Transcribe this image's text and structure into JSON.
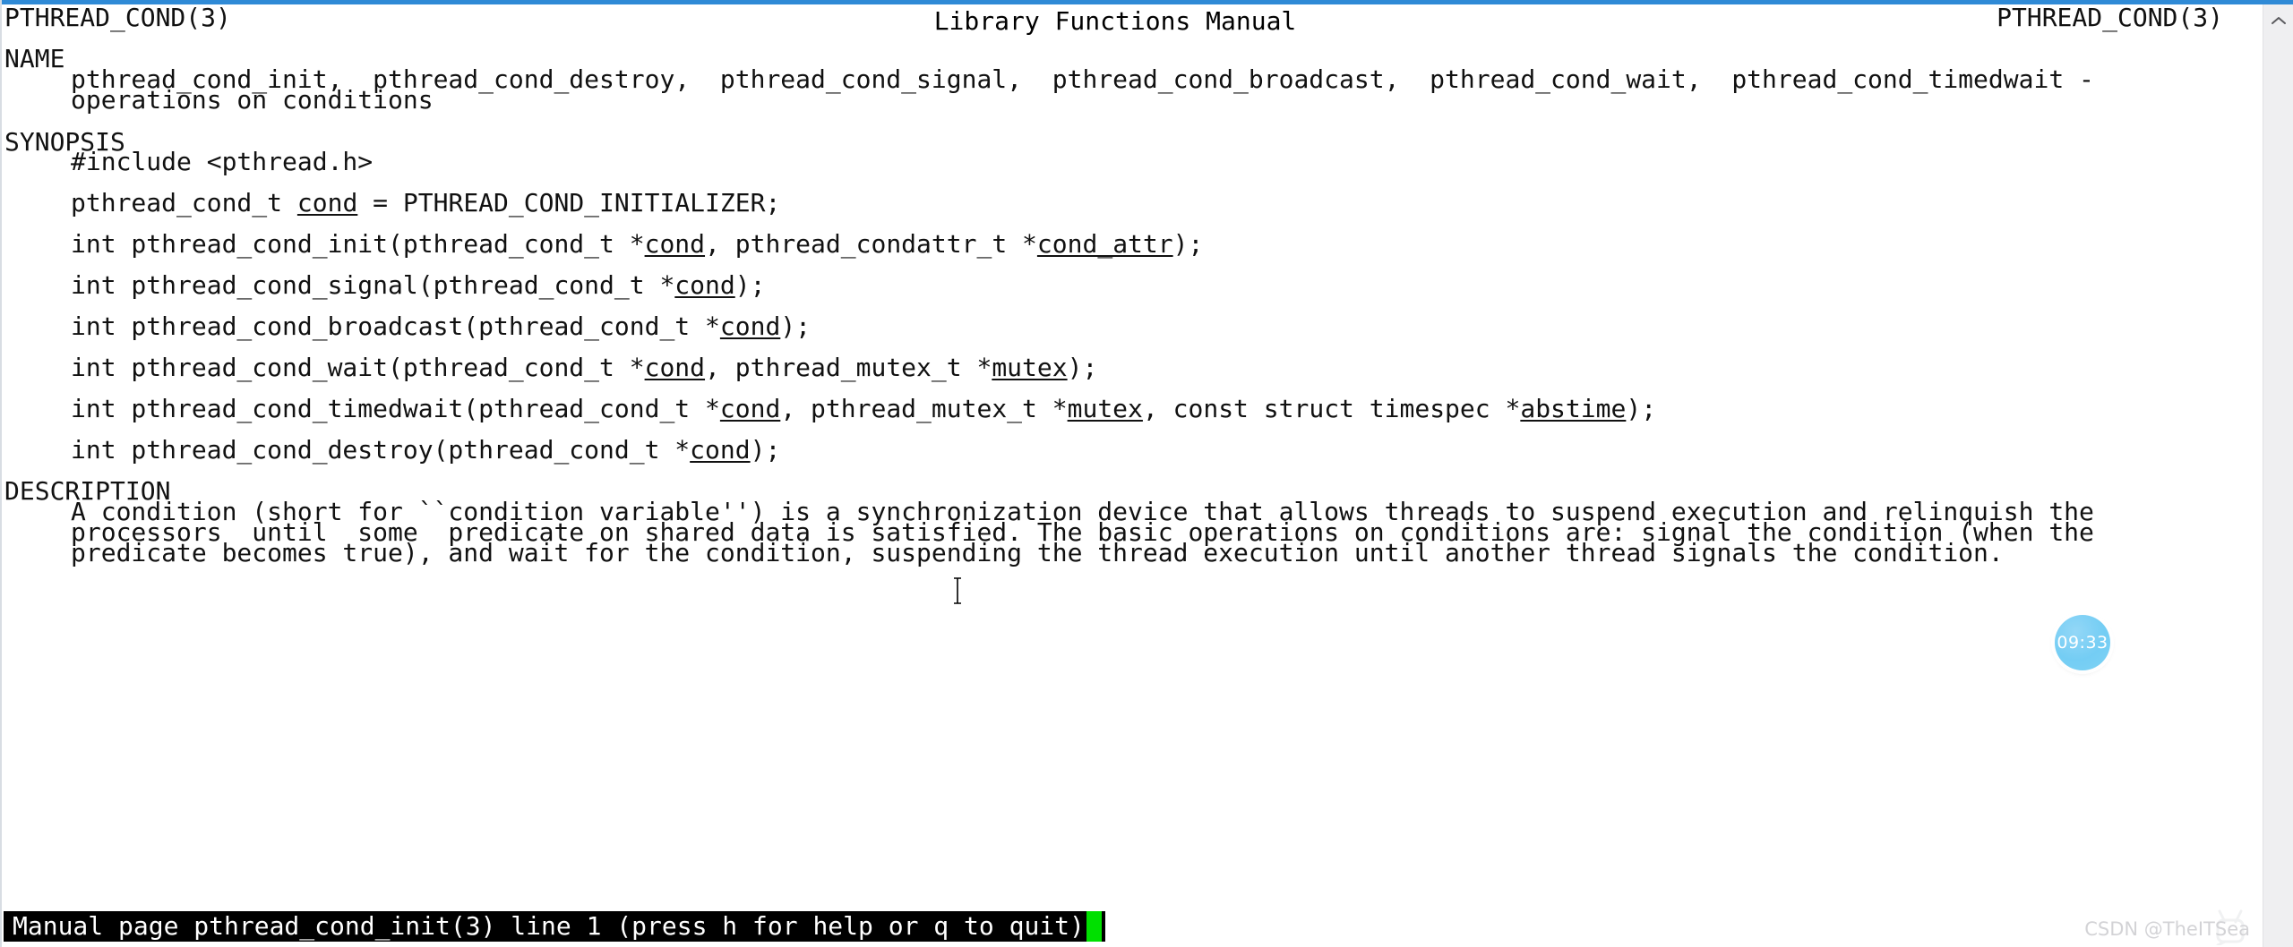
{
  "window": {
    "accent_color": "#2f8ad6",
    "background_color": "#ffffff",
    "text_color": "#000000"
  },
  "manpage": {
    "header": {
      "left": "PTHREAD_COND(3)",
      "center": "Library Functions Manual",
      "right": "PTHREAD_COND(3)"
    },
    "sections": [
      {
        "heading": "NAME",
        "lines": [
          "pthread_cond_init,  pthread_cond_destroy,  pthread_cond_signal,  pthread_cond_broadcast,  pthread_cond_wait,  pthread_cond_timedwait -",
          "operations on conditions"
        ]
      },
      {
        "heading": "SYNOPSIS",
        "lines": [
          "#include <pthread.h>",
          "pthread_cond_t cond = PTHREAD_COND_INITIALIZER;",
          "int pthread_cond_init(pthread_cond_t *cond, pthread_condattr_t *cond_attr);",
          "int pthread_cond_signal(pthread_cond_t *cond);",
          "int pthread_cond_broadcast(pthread_cond_t *cond);",
          "int pthread_cond_wait(pthread_cond_t *cond, pthread_mutex_t *mutex);",
          "int pthread_cond_timedwait(pthread_cond_t *cond, pthread_mutex_t *mutex, const struct timespec *abstime);",
          "int pthread_cond_destroy(pthread_cond_t *cond);"
        ]
      },
      {
        "heading": "DESCRIPTION",
        "lines": [
          "A condition (short for ``condition variable'') is a synchronization device that allows threads to suspend execution and relinquish the",
          "processors  until  some  predicate on shared data is satisfied. The basic operations on conditions are: signal the condition (when the",
          "predicate becomes true), and wait for the condition, suspending the thread execution until another thread signals the condition."
        ]
      }
    ],
    "synopsis_fragments": {
      "include": "#include <pthread.h>",
      "initializer": {
        "before": "pthread_cond_t ",
        "param": "cond",
        "after": " = PTHREAD_COND_INITIALIZER;"
      },
      "init": {
        "p1": "int pthread_cond_init(pthread_cond_t *",
        "a1": "cond",
        "p2": ", pthread_condattr_t *",
        "a2": "cond_attr",
        "p3": ");"
      },
      "signal": {
        "p1": "int pthread_cond_signal(pthread_cond_t *",
        "a1": "cond",
        "p2": ");"
      },
      "broadcast": {
        "p1": "int pthread_cond_broadcast(pthread_cond_t *",
        "a1": "cond",
        "p2": ");"
      },
      "wait": {
        "p1": "int pthread_cond_wait(pthread_cond_t *",
        "a1": "cond",
        "p2": ", pthread_mutex_t *",
        "a2": "mutex",
        "p3": ");"
      },
      "timedwait": {
        "p1": "int pthread_cond_timedwait(pthread_cond_t *",
        "a1": "cond",
        "p2": ", pthread_mutex_t *",
        "a2": "mutex",
        "p3": ", const struct timespec *",
        "a3": "abstime",
        "p4": ");"
      },
      "destroy": {
        "p1": "int pthread_cond_destroy(pthread_cond_t *",
        "a1": "cond",
        "p2": ");"
      }
    }
  },
  "statusbar": {
    "text": "Manual page pthread_cond_init(3) line 1 (press h for help or q to quit)",
    "cursor_color": "#00e000",
    "background_color": "#000000",
    "text_color": "#ffffff"
  },
  "clock_badge": {
    "time": "09:33",
    "color": "#7fd3f5"
  },
  "watermark": {
    "text": "CSDN @TheITSea"
  },
  "scrollbar": {
    "up_arrow_icon": "chevron-up-icon"
  }
}
